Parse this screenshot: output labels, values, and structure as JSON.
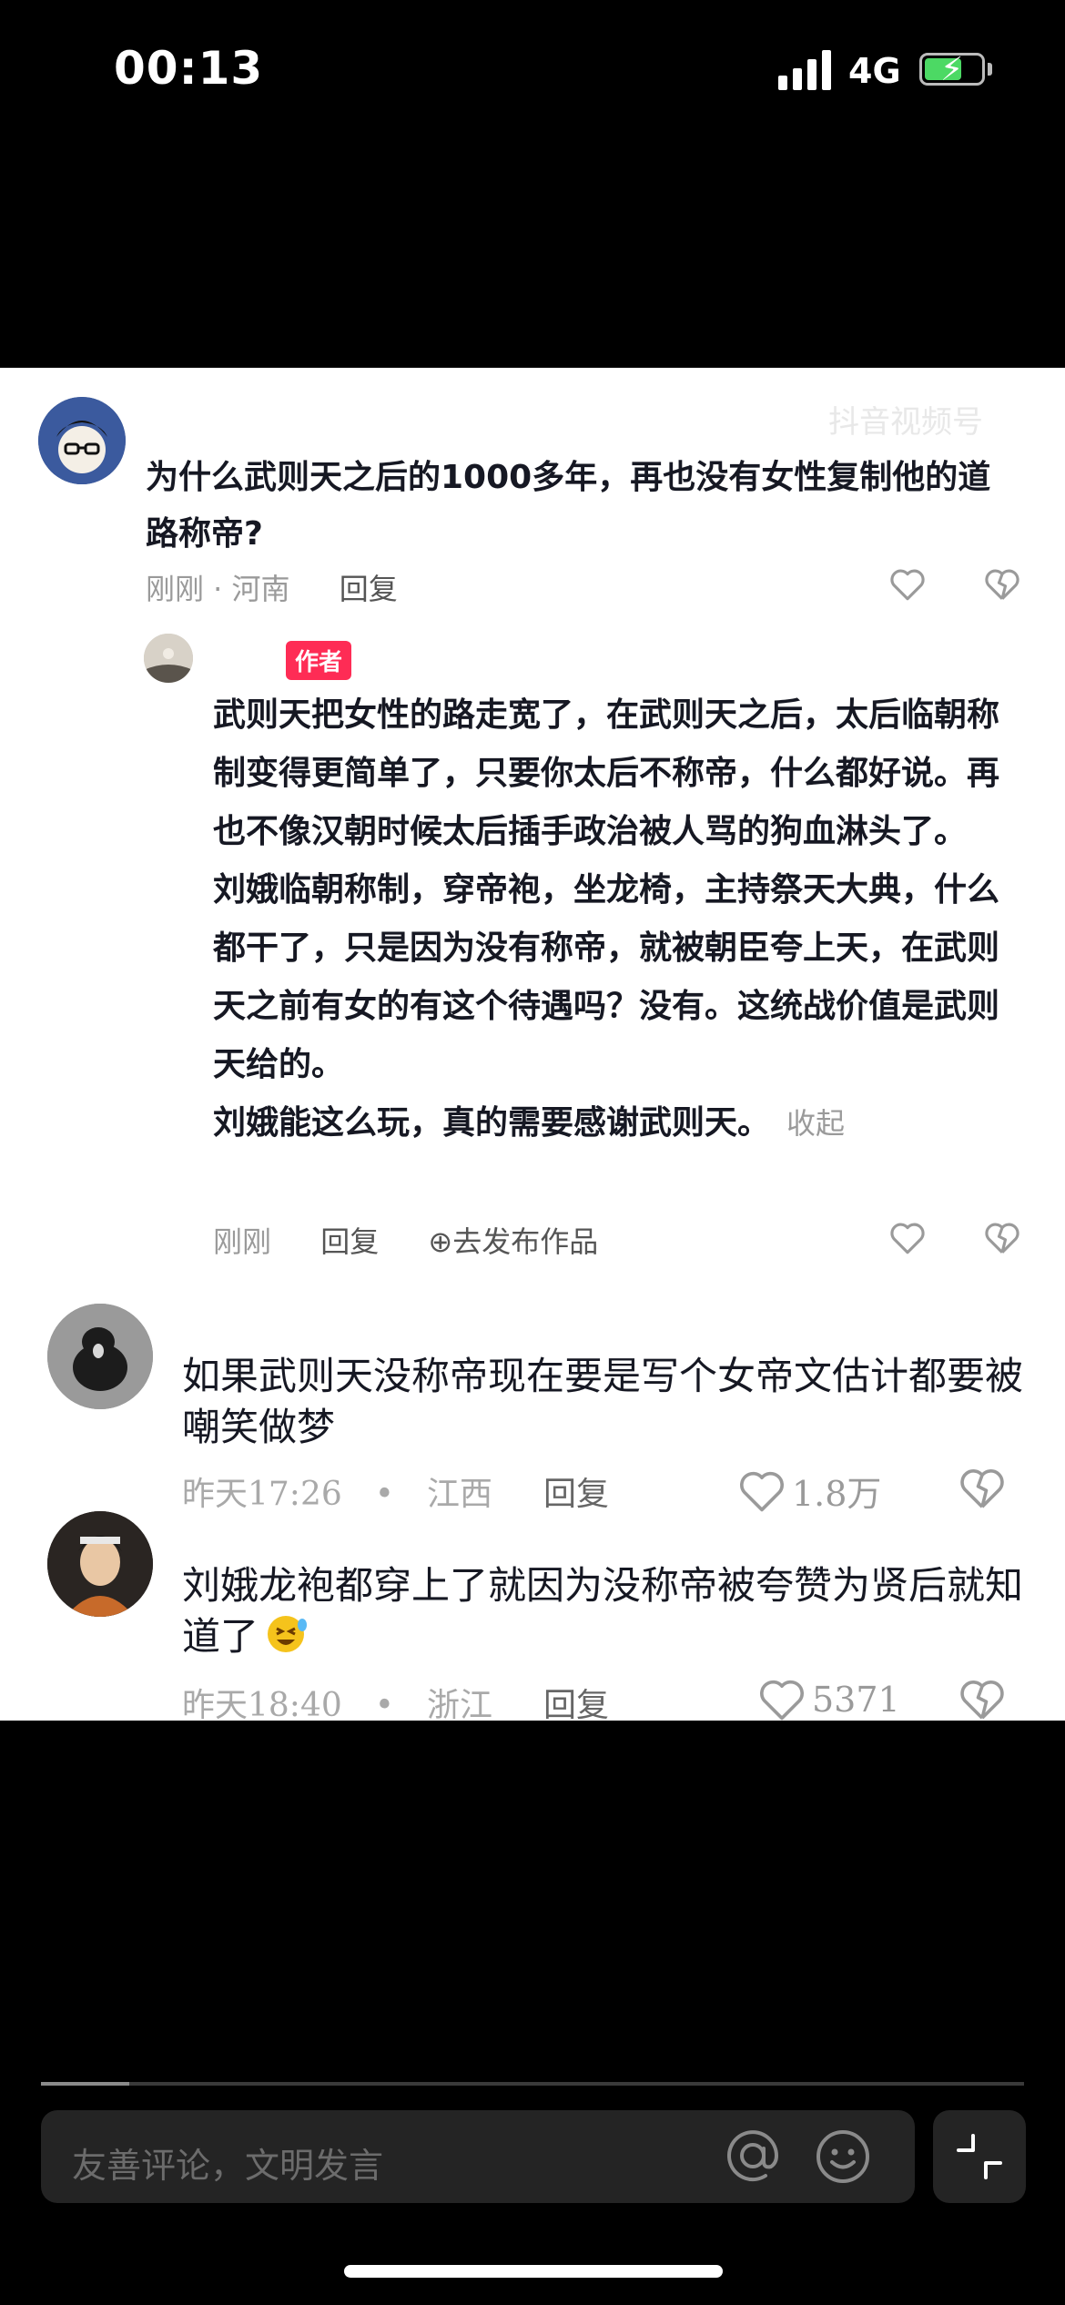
{
  "status_bar": {
    "time": "00:13",
    "network": "4G"
  },
  "comments": {
    "watermark": "抖音视频号",
    "c1": {
      "text": "为什么武则天之后的1000多年，再也没有女性复制他的道路称帝?",
      "meta": "刚刚 · 河南",
      "reply": "回复"
    },
    "c2": {
      "badge": "作者",
      "p1": "武则天把女性的路走宽了，在武则天之后，太后临朝称制变得更简单了，只要你太后不称帝，什么都好说。再也不像汉朝时候太后插手政治被人骂的狗血淋头了。",
      "p2": "刘娥临朝称制，穿帝袍，坐龙椅，主持祭天大典，什么都干了，只是因为没有称帝，就被朝臣夸上天，在武则天之前有女的有这个待遇吗？没有。这统战价值是武则天给的。",
      "p3": "刘娥能这么玩，真的需要感谢武则天。",
      "collapse": "收起",
      "time": "刚刚",
      "reply": "回复",
      "publish": "去发布作品"
    },
    "c3": {
      "text": "如果武则天没称帝现在要是写个女帝文估计都要被嘲笑做梦",
      "time": "昨天17:26",
      "location": "江西",
      "reply": "回复",
      "likes": "1.8万"
    },
    "c4": {
      "text": "刘娥龙袍都穿上了就因为没称帝被夸赞为贤后就知道了",
      "time": "昨天18:40",
      "location": "浙江",
      "reply": "回复",
      "likes": "5371"
    }
  },
  "bottom": {
    "placeholder": "友善评论，文明发言",
    "progress": 0.09
  },
  "colors": {
    "author_badge": "#fe2c55",
    "battery": "#4cd964"
  }
}
